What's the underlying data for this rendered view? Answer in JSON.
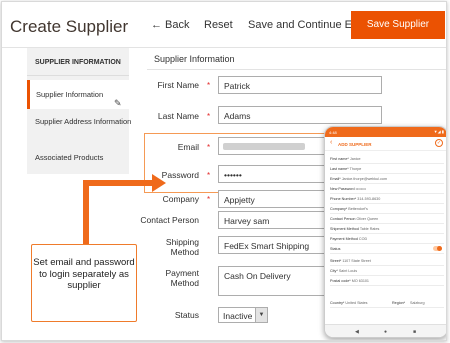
{
  "header": {
    "title": "Create Supplier",
    "back": "← Back",
    "reset": "Reset",
    "save_continue": "Save and Continue Edit",
    "save": "Save Supplier"
  },
  "sidebar": {
    "heading": "SUPPLIER INFORMATION",
    "items": [
      {
        "label": "Supplier Information"
      },
      {
        "label": "Supplier Address Information"
      },
      {
        "label": "Associated Products"
      }
    ]
  },
  "form": {
    "section_title": "Supplier Information",
    "first_name": {
      "label": "First Name",
      "value": "Patrick"
    },
    "last_name": {
      "label": "Last Name",
      "value": "Adams"
    },
    "email": {
      "label": "Email"
    },
    "password": {
      "label": "Password",
      "value": "••••••"
    },
    "company": {
      "label": "Company",
      "value": "Appjetty"
    },
    "contact_person": {
      "label": "Contact Person",
      "value": "Harvey sam"
    },
    "shipping_method": {
      "label": "Shipping Method",
      "value": "FedEx Smart Shipping"
    },
    "payment_method": {
      "label": "Payment Method",
      "value": "Cash On Delivery"
    },
    "status": {
      "label": "Status",
      "value": "Inactive"
    }
  },
  "callout": {
    "text": "Set email and password to login separately as supplier"
  },
  "phone": {
    "status_time": "4:48",
    "status_icons": "▼◢ ▮",
    "title": "ADD SUPPLIER",
    "rows": [
      {
        "label": "First name*",
        "value": "Janice"
      },
      {
        "label": "Last name*",
        "value": "Thorpe"
      },
      {
        "label": "Email*",
        "value": "Janice.thorpe@webkul.com"
      },
      {
        "label": "New Password",
        "value": "••••••••"
      },
      {
        "label": "Phone Number*",
        "value": "314-593-8630"
      },
      {
        "label": "Company*",
        "value": "Bettendorf's"
      },
      {
        "label": "Contact Person",
        "value": "Oliver Queen"
      },
      {
        "label": "Shipment Method",
        "value": "Table Rates"
      },
      {
        "label": "Payment Method",
        "value": "COD"
      },
      {
        "label": "Status",
        "value": ""
      },
      {
        "label": "Street*",
        "value": "1107 State Street"
      },
      {
        "label": "City*",
        "value": "Saint Louis"
      },
      {
        "label": "Postal code*",
        "value": "MO 63101"
      },
      {
        "label": "Country*",
        "value": "United States"
      }
    ],
    "region_label": "Region*",
    "region_value": "Salzburg"
  }
}
